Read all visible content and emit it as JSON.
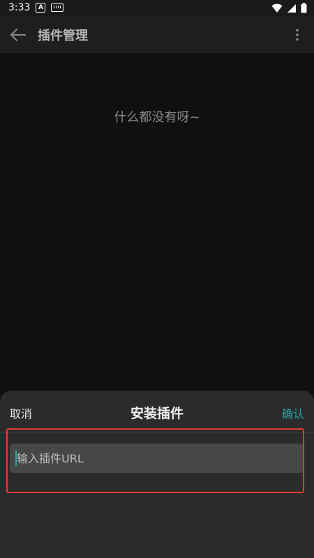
{
  "status_bar": {
    "time": "3:33",
    "a_badge": "A"
  },
  "app_bar": {
    "title": "插件管理"
  },
  "content": {
    "empty_message": "什么都没有呀~"
  },
  "sheet": {
    "cancel_label": "取消",
    "title": "安装插件",
    "confirm_label": "确认",
    "input_placeholder": "输入插件URL",
    "input_value": ""
  },
  "colors": {
    "accent": "#2aa6a6",
    "highlight": "#e53935"
  },
  "icons": [
    "back-arrow-icon",
    "more-vert-icon",
    "wifi-icon",
    "signal-icon",
    "battery-icon",
    "keyboard-icon"
  ]
}
